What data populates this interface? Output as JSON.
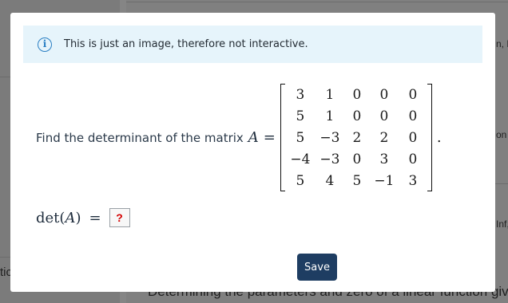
{
  "background": {
    "right_text_1": "n, B",
    "right_text_2": "on",
    "right_text_3": "Inf,",
    "left_text": "tic",
    "bottom_text": "Determining the parameters and zero of a linear function given"
  },
  "modal": {
    "alert": {
      "icon": "info-icon",
      "icon_glyph": "i",
      "text": "This is just an image, therefore not interactive."
    },
    "question": {
      "prefix": "Find the determinant of the matrix",
      "variable": "A",
      "equals": "=",
      "matrix": [
        [
          "3",
          "1",
          "0",
          "0",
          "0"
        ],
        [
          "5",
          "1",
          "0",
          "0",
          "0"
        ],
        [
          "5",
          "−3",
          "2",
          "2",
          "0"
        ],
        [
          "−4",
          "−3",
          "0",
          "3",
          "0"
        ],
        [
          "5",
          "4",
          "5",
          "−1",
          "3"
        ]
      ],
      "suffix": "."
    },
    "answer": {
      "label_fn": "det(",
      "label_var": "A",
      "label_close": ")",
      "equals": "=",
      "placeholder": "?"
    },
    "save_label": "Save"
  },
  "colors": {
    "alert_bg": "#e6f4fb",
    "info_icon": "#2a7fc3",
    "save_button": "#1e3d62",
    "answer_mark": "#d40000",
    "overlay": "#808080"
  }
}
